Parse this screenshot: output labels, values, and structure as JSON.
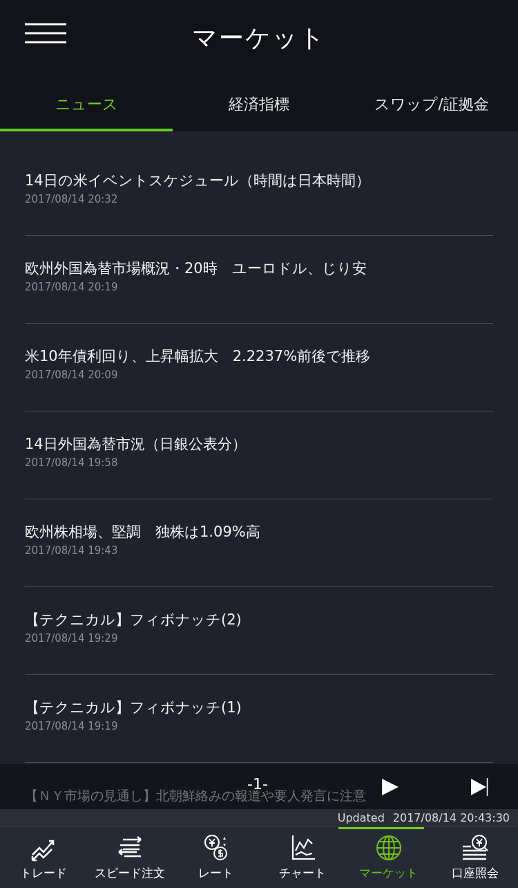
{
  "header": {
    "title": "マーケット"
  },
  "tabs": [
    {
      "label": "ニュース",
      "selected": true
    },
    {
      "label": "経済指標",
      "selected": false
    },
    {
      "label": "スワップ/証拠金",
      "selected": false
    }
  ],
  "news": [
    {
      "title": "14日の米イベントスケジュール（時間は日本時間）",
      "date": "2017/08/14 20:32"
    },
    {
      "title": "欧州外国為替市場概況・20時　ユーロドル、じり安",
      "date": "2017/08/14 20:19"
    },
    {
      "title": "米10年債利回り、上昇幅拡大　2.2237%前後で推移",
      "date": "2017/08/14 20:09"
    },
    {
      "title": "14日外国為替市況（日銀公表分）",
      "date": "2017/08/14 19:58"
    },
    {
      "title": "欧州株相場、堅調　独株は1.09%高",
      "date": "2017/08/14 19:43"
    },
    {
      "title": "【テクニカル】フィボナッチ(2)",
      "date": "2017/08/14 19:29"
    },
    {
      "title": "【テクニカル】フィボナッチ(1)",
      "date": "2017/08/14 19:19"
    },
    {
      "title": "【ＮＹ市場の見通し】北朝鮮絡みの報道や要人発言に注意"
    }
  ],
  "pager": {
    "page": "-1-"
  },
  "updated": {
    "label": "Updated",
    "time": "2017/08/14 20:43:30"
  },
  "nav": [
    {
      "kind": "trade",
      "label": "トレード",
      "selected": false
    },
    {
      "kind": "speed",
      "label": "スピード注文",
      "selected": false
    },
    {
      "kind": "rate",
      "label": "レート",
      "selected": false
    },
    {
      "kind": "chart",
      "label": "チャート",
      "selected": false
    },
    {
      "kind": "market",
      "label": "マーケット",
      "selected": true
    },
    {
      "kind": "account",
      "label": "口座照会",
      "selected": false
    }
  ]
}
